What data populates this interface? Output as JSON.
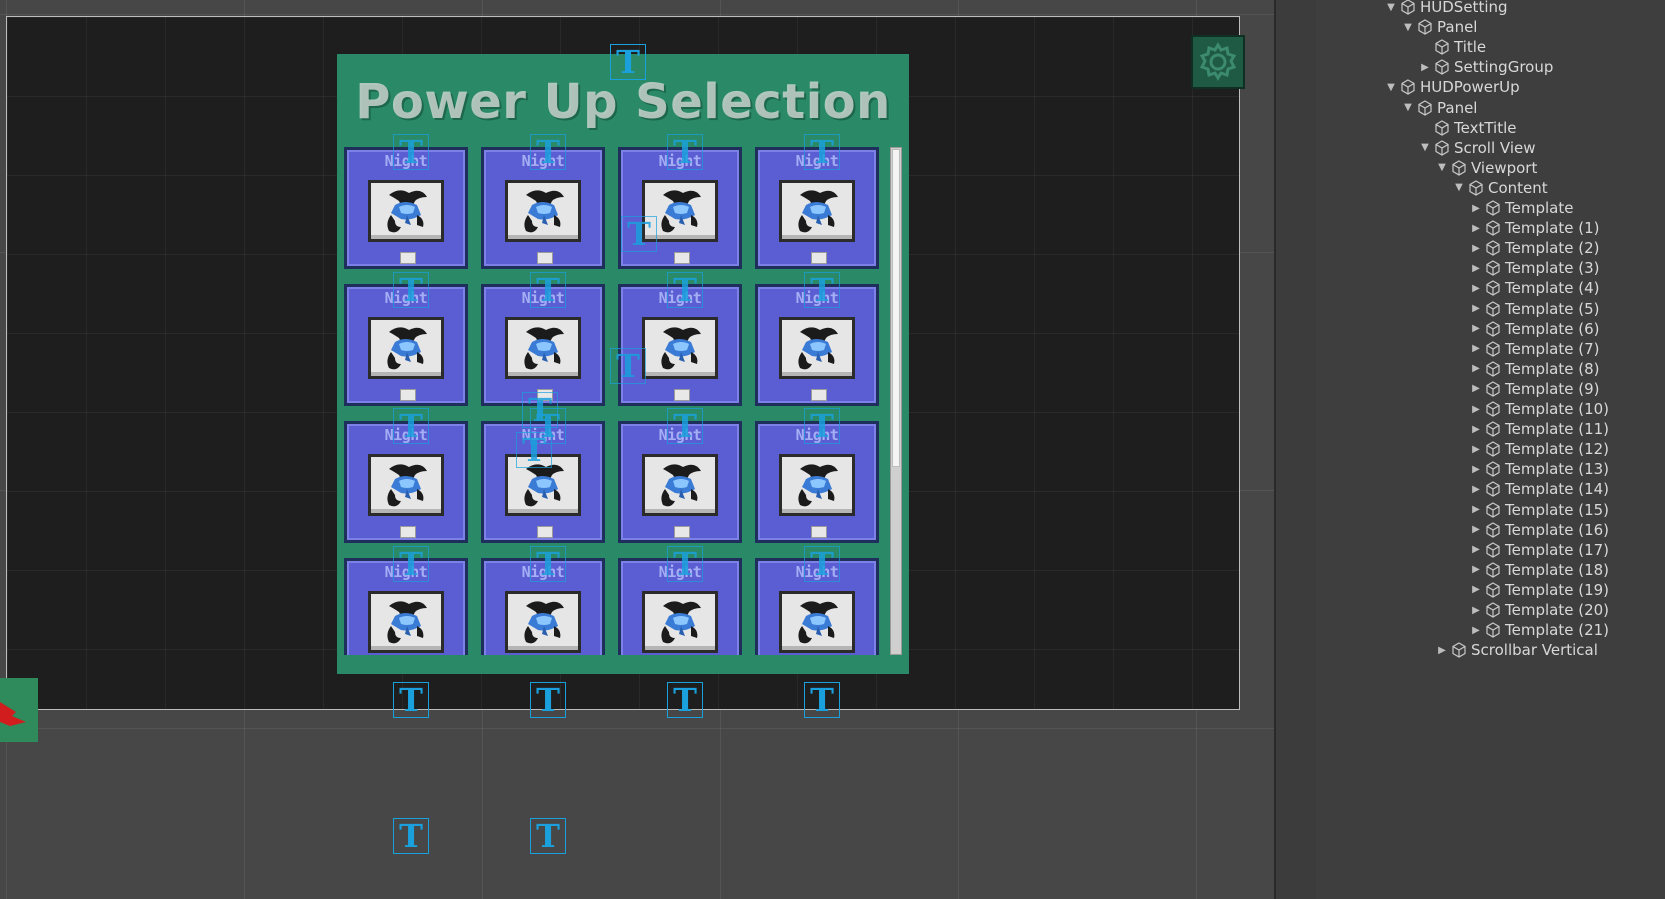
{
  "scene": {
    "panel_title": "Power Up Selection",
    "card_label": "Night",
    "gizmo_letter": "T",
    "colors": {
      "panel": "#2a8a68",
      "card": "#5b5ed3",
      "canvas": "#1e1e1e",
      "gizmo": "#1aa0dc"
    },
    "icons": {
      "settings": "gear-icon",
      "card": "pixel-creature-icon",
      "tool": "red-arrow-icon"
    }
  },
  "hierarchy": {
    "rows": [
      {
        "label": "HUDSetting",
        "depth": 0,
        "arrow": "down"
      },
      {
        "label": "Panel",
        "depth": 1,
        "arrow": "down"
      },
      {
        "label": "Title",
        "depth": 2,
        "arrow": "none"
      },
      {
        "label": "SettingGroup",
        "depth": 2,
        "arrow": "right"
      },
      {
        "label": "HUDPowerUp",
        "depth": 0,
        "arrow": "down"
      },
      {
        "label": "Panel",
        "depth": 1,
        "arrow": "down"
      },
      {
        "label": "TextTitle",
        "depth": 2,
        "arrow": "none"
      },
      {
        "label": "Scroll View",
        "depth": 2,
        "arrow": "down"
      },
      {
        "label": "Viewport",
        "depth": 3,
        "arrow": "down"
      },
      {
        "label": "Content",
        "depth": 4,
        "arrow": "down"
      },
      {
        "label": "Template",
        "depth": 5,
        "arrow": "right"
      },
      {
        "label": "Template (1)",
        "depth": 5,
        "arrow": "right"
      },
      {
        "label": "Template (2)",
        "depth": 5,
        "arrow": "right"
      },
      {
        "label": "Template (3)",
        "depth": 5,
        "arrow": "right"
      },
      {
        "label": "Template (4)",
        "depth": 5,
        "arrow": "right"
      },
      {
        "label": "Template (5)",
        "depth": 5,
        "arrow": "right"
      },
      {
        "label": "Template (6)",
        "depth": 5,
        "arrow": "right"
      },
      {
        "label": "Template (7)",
        "depth": 5,
        "arrow": "right"
      },
      {
        "label": "Template (8)",
        "depth": 5,
        "arrow": "right"
      },
      {
        "label": "Template (9)",
        "depth": 5,
        "arrow": "right"
      },
      {
        "label": "Template (10)",
        "depth": 5,
        "arrow": "right"
      },
      {
        "label": "Template (11)",
        "depth": 5,
        "arrow": "right"
      },
      {
        "label": "Template (12)",
        "depth": 5,
        "arrow": "right"
      },
      {
        "label": "Template (13)",
        "depth": 5,
        "arrow": "right"
      },
      {
        "label": "Template (14)",
        "depth": 5,
        "arrow": "right"
      },
      {
        "label": "Template (15)",
        "depth": 5,
        "arrow": "right"
      },
      {
        "label": "Template (16)",
        "depth": 5,
        "arrow": "right"
      },
      {
        "label": "Template (17)",
        "depth": 5,
        "arrow": "right"
      },
      {
        "label": "Template (18)",
        "depth": 5,
        "arrow": "right"
      },
      {
        "label": "Template (19)",
        "depth": 5,
        "arrow": "right"
      },
      {
        "label": "Template (20)",
        "depth": 5,
        "arrow": "right"
      },
      {
        "label": "Template (21)",
        "depth": 5,
        "arrow": "right"
      },
      {
        "label": "Scrollbar Vertical",
        "depth": 3,
        "arrow": "right"
      }
    ]
  }
}
